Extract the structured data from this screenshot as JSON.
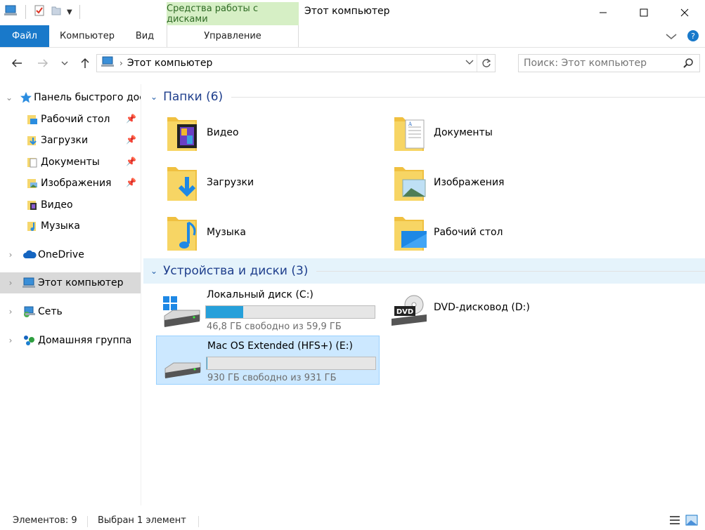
{
  "window": {
    "title": "Этот компьютер",
    "context_tab_group": "Средства работы с дисками"
  },
  "ribbon": {
    "tabs": [
      {
        "label": "Файл"
      },
      {
        "label": "Компьютер"
      },
      {
        "label": "Вид"
      },
      {
        "label": "Управление"
      }
    ]
  },
  "address": {
    "path": "Этот компьютер",
    "search_placeholder": "Поиск: Этот компьютер"
  },
  "nav": {
    "quick_access": "Панель быстрого доступа",
    "items": [
      {
        "label": "Рабочий стол",
        "pinned": true
      },
      {
        "label": "Загрузки",
        "pinned": true
      },
      {
        "label": "Документы",
        "pinned": true
      },
      {
        "label": "Изображения",
        "pinned": true
      },
      {
        "label": "Видео",
        "pinned": false
      },
      {
        "label": "Музыка",
        "pinned": false
      }
    ],
    "onedrive": "OneDrive",
    "this_pc": "Этот компьютер",
    "network": "Сеть",
    "homegroup": "Домашняя группа"
  },
  "folders_group": {
    "title": "Папки (6)",
    "folders": [
      {
        "name": "Видео",
        "icon": "video-folder-icon"
      },
      {
        "name": "Документы",
        "icon": "documents-folder-icon"
      },
      {
        "name": "Загрузки",
        "icon": "downloads-folder-icon"
      },
      {
        "name": "Изображения",
        "icon": "pictures-folder-icon"
      },
      {
        "name": "Музыка",
        "icon": "music-folder-icon"
      },
      {
        "name": "Рабочий стол",
        "icon": "desktop-folder-icon"
      }
    ]
  },
  "drives_group": {
    "title": "Устройства и диски (3)",
    "drives": [
      {
        "name": "Локальный диск (C:)",
        "free": "46,8 ГБ свободно из 59,9 ГБ",
        "used_fraction": 0.22
      },
      {
        "name": "DVD-дисковод (D:)"
      },
      {
        "name": "Mac OS Extended (HFS+) (E:)",
        "free": "930 ГБ свободно из 931 ГБ",
        "used_fraction": 0.001
      }
    ]
  },
  "status": {
    "count": "Элементов: 9",
    "selected": "Выбран 1 элемент"
  },
  "colors": {
    "accent": "#1979ca",
    "context_tab": "#d6efc5",
    "selection": "#cce8ff",
    "group_title": "#1e3e8c",
    "drive_bar": "#26a0da"
  }
}
